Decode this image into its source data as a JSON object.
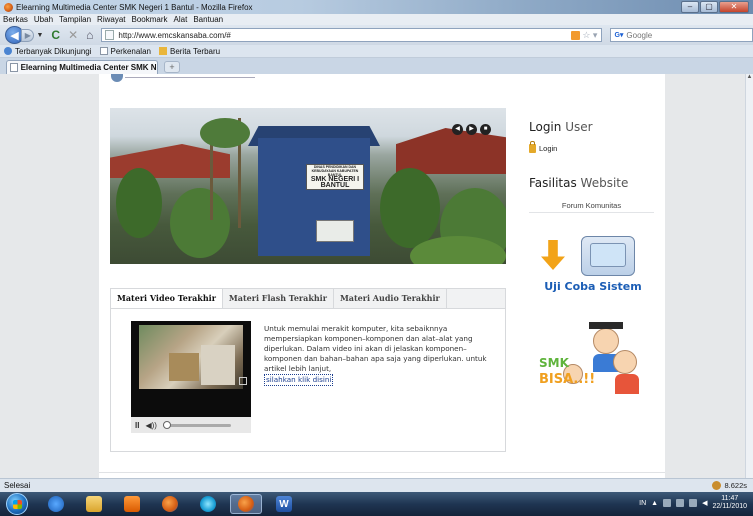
{
  "window": {
    "title": "Elearning Multimedia Center SMK Negeri 1 Bantul - Mozilla Firefox",
    "controls": [
      "–",
      "▢",
      "✕"
    ]
  },
  "menu": [
    "Berkas",
    "Ubah",
    "Tampilan",
    "Riwayat",
    "Bookmark",
    "Alat",
    "Bantuan"
  ],
  "nav": {
    "url": "http://www.emcskansaba.com/#",
    "search_placeholder": "Google"
  },
  "bookmarks": [
    "Terbanyak Dikunjungi",
    "Perkenalan",
    "Berita Terbaru"
  ],
  "tabs": {
    "active_label": "Elearning Multimedia Center SMK Ne...",
    "new_tab": "+"
  },
  "slider": {
    "sign_top": "DINAS PENDIDIKAN DAN KEBUDAYAAN KABUPATEN BANTUL",
    "sign_main": "SMK NEGERI I BANTUL",
    "nav_buttons": [
      "◀",
      "▶",
      "■"
    ]
  },
  "materi": {
    "tabs": [
      "Materi Video Terakhir",
      "Materi Flash Terakhir",
      "Materi Audio Terakhir"
    ],
    "description": "Untuk memulai merakit komputer, kita sebaiknnya mempersiapkan komponen–komponen dan alat–alat yang diperlukan. Dalam video ini akan di jelaskan komponen–komponen dan bahan–bahan apa saja yang diperlukan. untuk artikel lebih lanjut,",
    "link": "silahkan klik disini",
    "controls": {
      "pause": "II",
      "volume": "◀))"
    },
    "seek_progress": 0.0
  },
  "sidebar": {
    "login_title_main": "Login",
    "login_title_light": "User",
    "login_link": "Login",
    "fasilitas_main": "Fasilitas",
    "fasilitas_light": "Website",
    "forum": "Forum Komunitas",
    "banner1": "Uji Coba Sistem",
    "banner2_line1": "SMK",
    "banner2_line2": "BISA..!!"
  },
  "status": {
    "text": "Selesai",
    "timer": "8.622s"
  },
  "taskbar": {
    "lang": "IN",
    "time": "11:47",
    "date": "22/11/2010"
  }
}
